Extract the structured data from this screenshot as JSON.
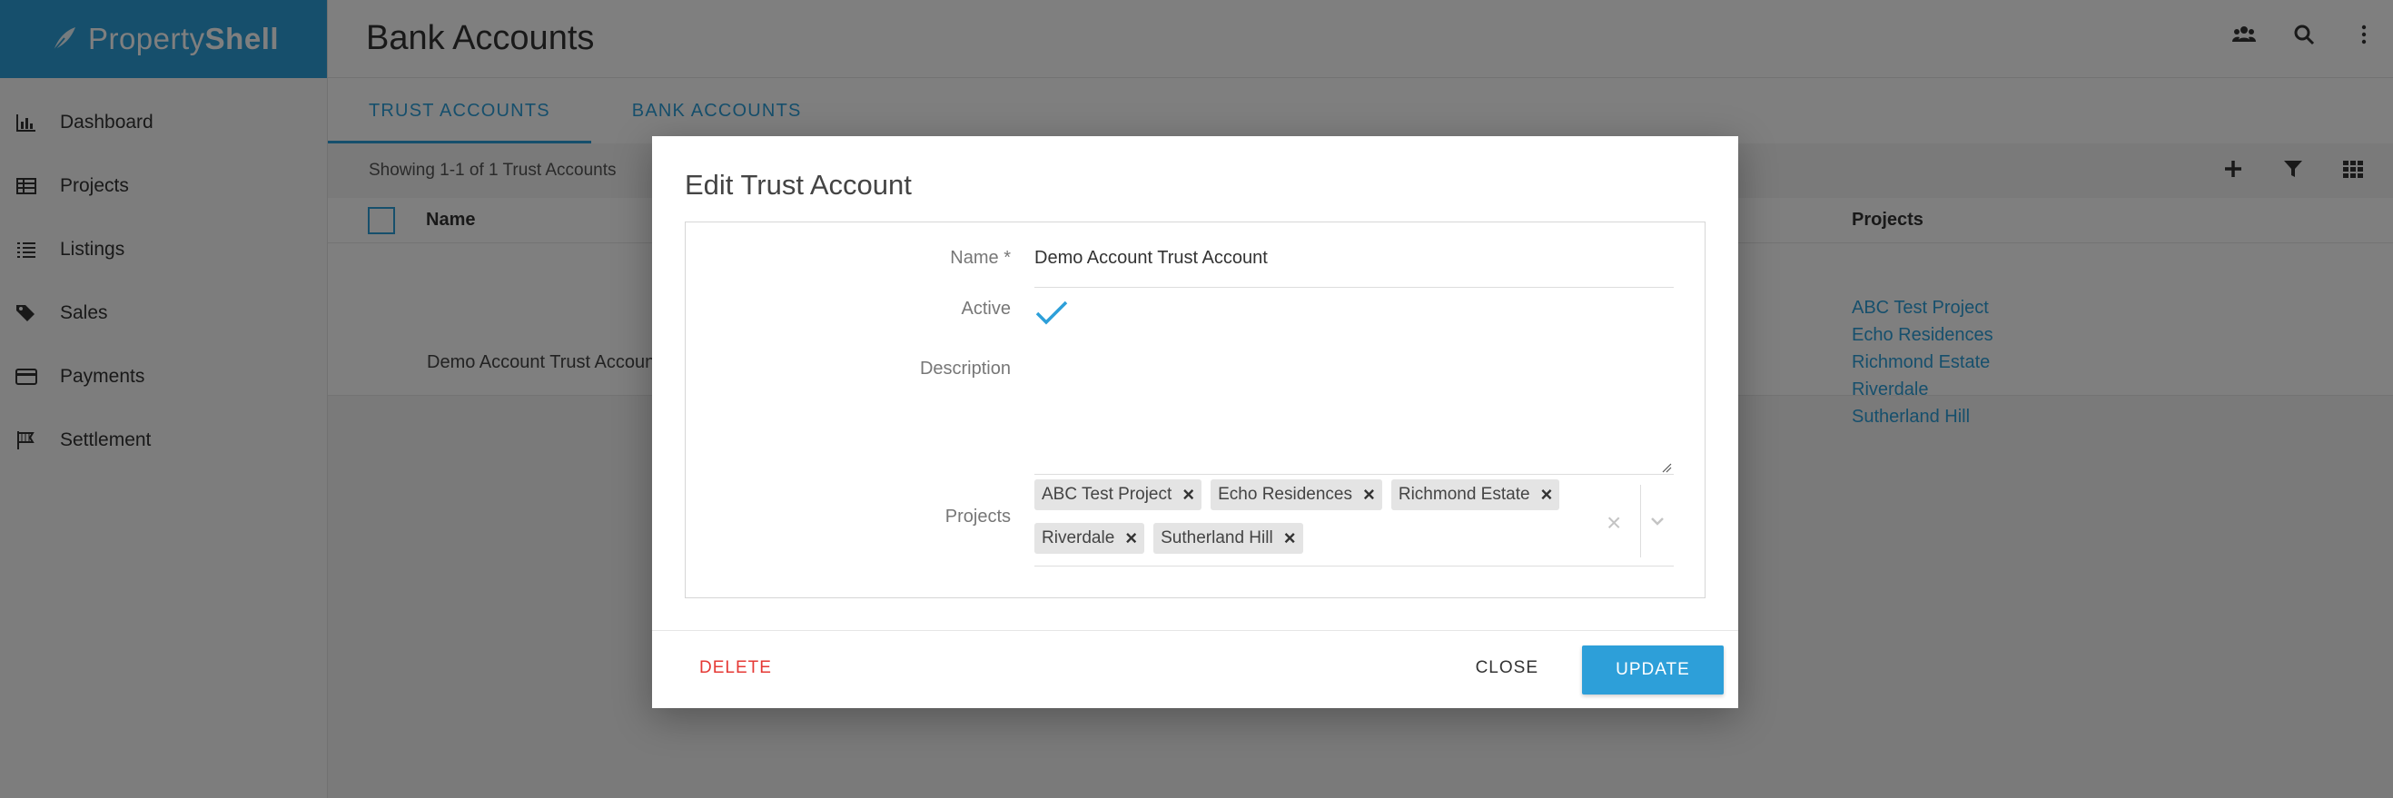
{
  "brand": {
    "name_light": "Property",
    "name_bold": "Shell"
  },
  "sidebar": {
    "items": [
      {
        "label": "Dashboard",
        "icon": "bar-chart-icon"
      },
      {
        "label": "Projects",
        "icon": "table-icon"
      },
      {
        "label": "Listings",
        "icon": "list-icon"
      },
      {
        "label": "Sales",
        "icon": "tags-icon"
      },
      {
        "label": "Payments",
        "icon": "credit-card-icon"
      },
      {
        "label": "Settlement",
        "icon": "flag-icon"
      }
    ]
  },
  "header": {
    "title": "Bank Accounts"
  },
  "tabs": [
    {
      "label": "TRUST ACCOUNTS",
      "active": true
    },
    {
      "label": "BANK ACCOUNTS",
      "active": false
    }
  ],
  "toolbar": {
    "showing_text": "Showing 1-1 of 1 Trust Accounts"
  },
  "table": {
    "columns": {
      "name": "Name",
      "projects": "Projects"
    },
    "rows": [
      {
        "name": "Demo Account Trust Account",
        "projects": [
          "ABC Test Project",
          "Echo Residences",
          "Richmond Estate",
          "Riverdale",
          "Sutherland Hill"
        ]
      }
    ]
  },
  "modal": {
    "title": "Edit Trust Account",
    "name_label": "Name *",
    "name_value": "Demo Account Trust Account",
    "active_label": "Active",
    "active_checked": true,
    "description_label": "Description",
    "description_value": "",
    "projects_label": "Projects",
    "projects": [
      "ABC Test Project",
      "Echo Residences",
      "Richmond Estate",
      "Riverdale",
      "Sutherland Hill"
    ],
    "chip_remove": "×",
    "clear_all": "×",
    "delete_label": "DELETE",
    "close_label": "CLOSE",
    "update_label": "UPDATE"
  },
  "colors": {
    "accent": "#2d9fd9",
    "danger": "#e53935"
  }
}
